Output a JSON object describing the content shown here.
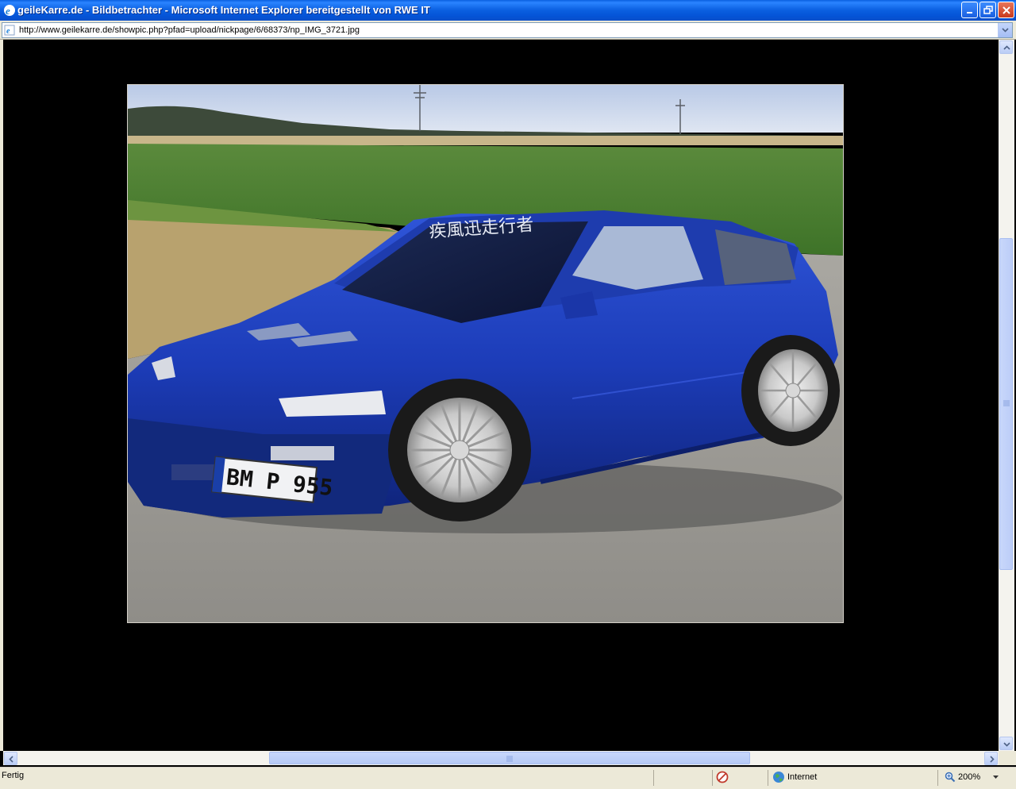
{
  "window": {
    "title": "geileKarre.de - Bildbetrachter - Microsoft Internet Explorer bereitgestellt von RWE IT"
  },
  "address": {
    "url": "http://www.geilekarre.de/showpic.php?pfad=upload/nickpage/6/68373/np_IMG_3721.jpg"
  },
  "image": {
    "plate_text": "BM P 955",
    "windshield_text": "疾風迅走行者"
  },
  "status": {
    "text": "Fertig",
    "zone": "Internet",
    "zoom": "200%"
  },
  "icons": {
    "ie": "ie-logo-icon",
    "blocked": "popup-blocked-icon",
    "zone": "globe-icon",
    "zoom": "magnifier-icon"
  },
  "colors": {
    "titlebar": "#0a5fe0",
    "chrome": "#ece9d8",
    "car_blue": "#1f3fbf"
  }
}
